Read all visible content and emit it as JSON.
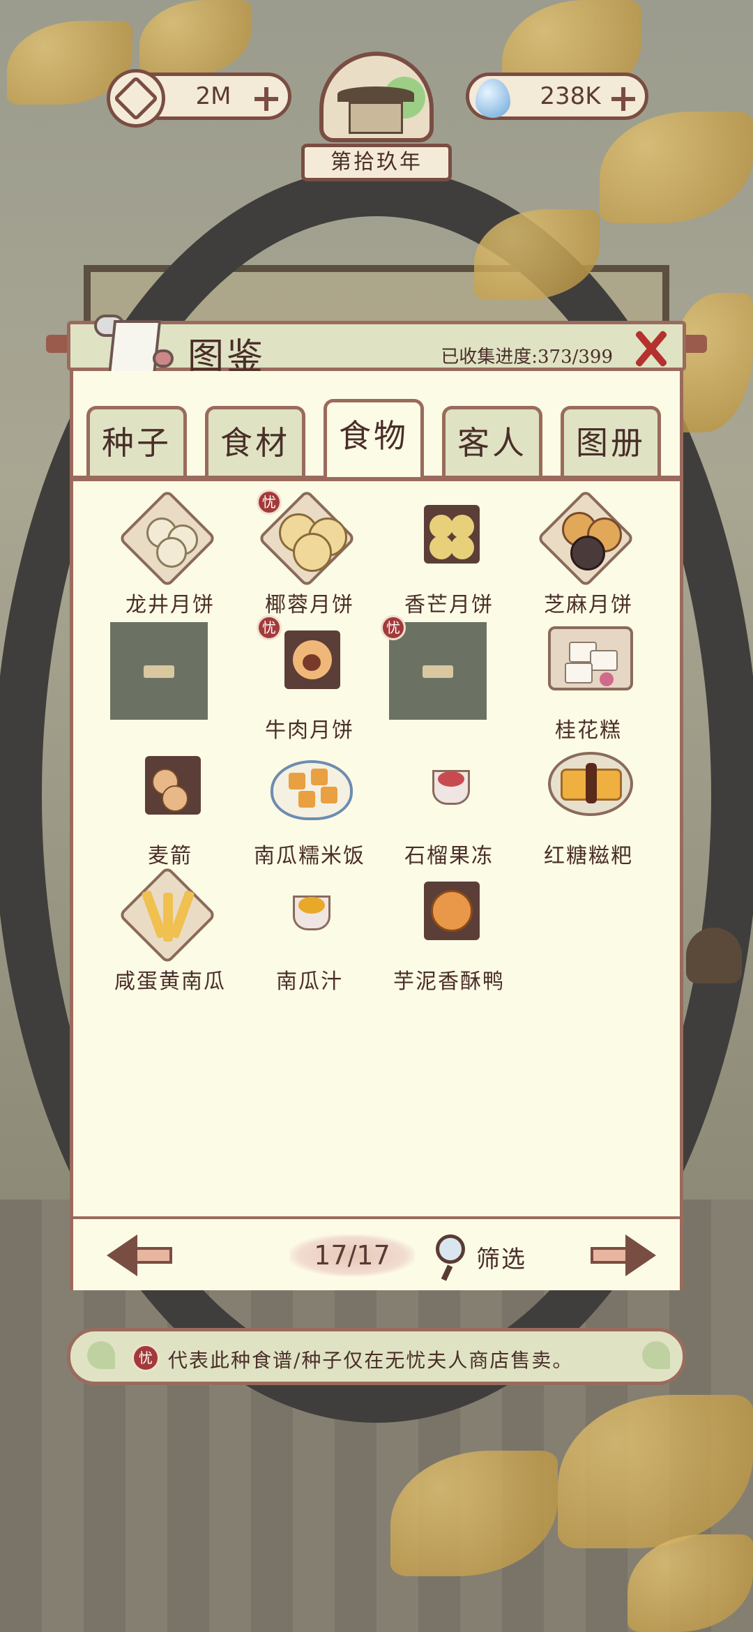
{
  "currency": {
    "coins": "2M",
    "water": "238K"
  },
  "year_label": "第拾玖年",
  "panel": {
    "title": "图鉴",
    "progress": "已收集进度:373/399"
  },
  "tabs": [
    {
      "label": "种子",
      "active": false
    },
    {
      "label": "食材",
      "active": false
    },
    {
      "label": "食物",
      "active": true
    },
    {
      "label": "客人",
      "active": false
    },
    {
      "label": "图册",
      "active": false
    }
  ],
  "badge_char": "忧",
  "items": [
    {
      "name": "龙井月饼",
      "icon": "longjing-mooncake-icon",
      "locked": false,
      "badge": false
    },
    {
      "name": "椰蓉月饼",
      "icon": "coconut-mooncake-icon",
      "locked": false,
      "badge": true
    },
    {
      "name": "香芒月饼",
      "icon": "mango-mooncake-icon",
      "locked": false,
      "badge": false
    },
    {
      "name": "芝麻月饼",
      "icon": "sesame-mooncake-icon",
      "locked": false,
      "badge": false
    },
    {
      "name": "",
      "icon": "locked-slot-icon",
      "locked": true,
      "badge": false
    },
    {
      "name": "牛肉月饼",
      "icon": "beef-mooncake-icon",
      "locked": false,
      "badge": true
    },
    {
      "name": "",
      "icon": "locked-slot-icon",
      "locked": true,
      "badge": true
    },
    {
      "name": "桂花糕",
      "icon": "osmanthus-cake-icon",
      "locked": false,
      "badge": false
    },
    {
      "name": "麦箭",
      "icon": "wheat-cake-icon",
      "locked": false,
      "badge": false
    },
    {
      "name": "南瓜糯米饭",
      "icon": "pumpkin-rice-icon",
      "locked": false,
      "badge": false
    },
    {
      "name": "石榴果冻",
      "icon": "pomegranate-jelly-icon",
      "locked": false,
      "badge": false
    },
    {
      "name": "红糖糍粑",
      "icon": "brown-sugar-ciba-icon",
      "locked": false,
      "badge": false
    },
    {
      "name": "咸蛋黄南瓜",
      "icon": "salted-yolk-pumpkin-icon",
      "locked": false,
      "badge": false
    },
    {
      "name": "南瓜汁",
      "icon": "pumpkin-juice-icon",
      "locked": false,
      "badge": false
    },
    {
      "name": "芋泥香酥鸭",
      "icon": "taro-duck-icon",
      "locked": false,
      "badge": false
    }
  ],
  "pager": {
    "page": "17/17",
    "filter_label": "筛选"
  },
  "footer": {
    "note": "代表此种食谱/种子仅在无忧夫人商店售卖。"
  },
  "colors": {
    "frame": "#9a6b5d",
    "header_bg": "#dfe3c4",
    "body_bg": "#fcfbe6",
    "text": "#4a2e28",
    "badge": "#a33a3a"
  }
}
